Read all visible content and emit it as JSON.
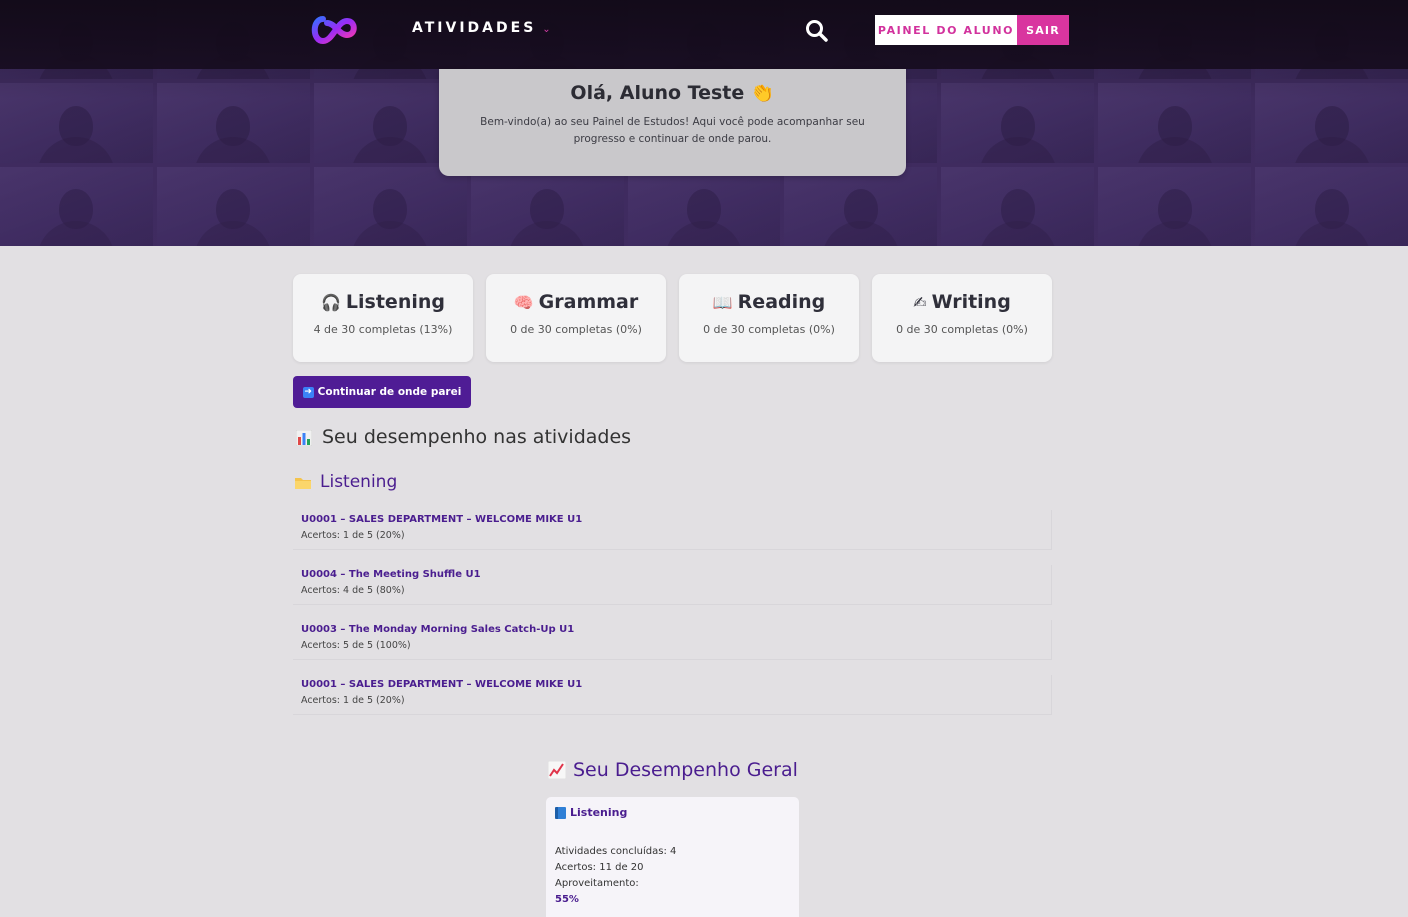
{
  "nav": {
    "menu_label": "ATIVIDADES",
    "painel_label": "PAINEL DO ALUNO",
    "sair_label": "SAIR"
  },
  "greeting": {
    "title": "Olá, Aluno Teste 👏",
    "subtitle": "Bem-vindo(a) ao seu Painel de Estudos! Aqui você pode acompanhar seu progresso e continuar de onde parou."
  },
  "skills": [
    {
      "icon": "🎧",
      "icon_name": "headphones-icon",
      "name": "Listening",
      "progress": "4 de 30 completas (13%)"
    },
    {
      "icon": "🧠",
      "icon_name": "brain-icon",
      "name": "Grammar",
      "progress": "0 de 30 completas (0%)"
    },
    {
      "icon": "📖",
      "icon_name": "open-book-icon",
      "name": "Reading",
      "progress": "0 de 30 completas (0%)"
    },
    {
      "icon": "✍",
      "icon_name": "writing-hand-icon",
      "name": "Writing",
      "progress": "0 de 30 completas (0%)"
    }
  ],
  "continue_button": "Continuar de onde parei",
  "performance": {
    "title": "Seu desempenho nas atividades",
    "category": "Listening",
    "activities": [
      {
        "title": "U0001 – SALES DEPARTMENT – WELCOME MIKE U1",
        "score": "Acertos: 1 de 5 (20%)"
      },
      {
        "title": "U0004 – The Meeting Shuffle U1",
        "score": "Acertos: 4 de 5 (80%)"
      },
      {
        "title": "U0003 – The Monday Morning Sales Catch-Up U1",
        "score": "Acertos: 5 de 5 (100%)"
      },
      {
        "title": "U0001 – SALES DEPARTMENT – WELCOME MIKE U1",
        "score": "Acertos: 1 de 5 (20%)"
      }
    ]
  },
  "overall": {
    "title": "Seu Desempenho Geral",
    "card": {
      "heading": "Listening",
      "completed": "Atividades concluídas: 4",
      "hits": "Acertos: 11 de 20",
      "usage_label": "Aproveitamento:",
      "usage_value": "55%"
    }
  },
  "colors": {
    "accent_purple": "#4f1c95",
    "brand_pink": "#d9359f",
    "page_bg": "#e2e0e3"
  }
}
